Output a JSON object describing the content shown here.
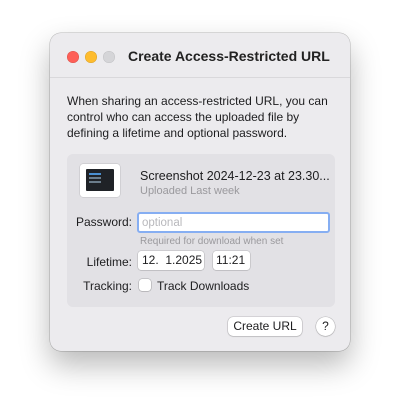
{
  "window": {
    "title": "Create Access-Restricted URL"
  },
  "description": "When sharing an access-restricted URL, you can control who can access the uploaded file by defining a lifetime and optional password.",
  "file": {
    "name": "Screenshot 2024-12-23 at 23.30...",
    "status": "Uploaded Last week"
  },
  "password": {
    "label": "Password:",
    "value": "",
    "placeholder": "optional",
    "hint": "Required for download when set"
  },
  "lifetime": {
    "label": "Lifetime:",
    "date": "12.  1.2025",
    "time": "11:21"
  },
  "tracking": {
    "label": "Tracking:",
    "checkbox_label": "Track Downloads",
    "checked": false
  },
  "buttons": {
    "create": "Create URL",
    "help": "?"
  },
  "colors": {
    "close": "#fe5f57",
    "minimize": "#febc2e",
    "zoom_disabled": "#d5d5d8",
    "focus_ring": "#86aef2"
  }
}
